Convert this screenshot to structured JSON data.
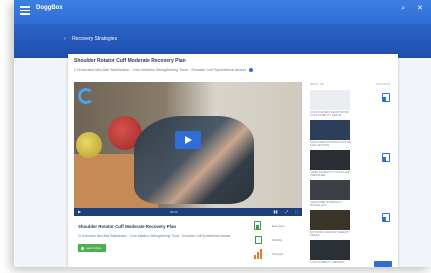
{
  "appbar": {
    "brand": "DoggBox",
    "right_icons": [
      "⌕",
      "✕"
    ]
  },
  "banner": {
    "back_label": "Recovery Strategies"
  },
  "page": {
    "title": "Shoulder Rotator Cuff Moderate Recovery Plan",
    "subtitle": "CI Exercises Mini-Ball Stabilization · Core Initiation Strengthening Trunk · Shoulder Cuff Symmetrical Awarer"
  },
  "video": {
    "controls": {
      "play": "▶",
      "time": "00:00",
      "right": [
        "▮▮",
        "⤢",
        "⛶"
      ]
    }
  },
  "info": {
    "title": "Shoulder Rotator Cuff Moderate Recovery Plan",
    "subtitle": "CI Exercises Mini-Ball Stabilization · Core Initiation Strengthening Trunk · Shoulder Cuff Symmetrical Awarer",
    "learn_button": "Learn More",
    "stats": [
      {
        "label": "Exposure",
        "icon": "meter-icon",
        "color": "#3a9b4a"
      },
      {
        "label": "Mobility",
        "icon": "gate-icon",
        "color": "#3a9b4a"
      },
      {
        "label": "Strength",
        "icon": "bars-icon",
        "color": "#e07b22"
      }
    ]
  },
  "related": {
    "head_left": "NEXT UP",
    "head_right": "APPLIED",
    "items": [
      {
        "text": "FOCUS EXERCISE ROTATOR CUFF MOBILITY SETUP",
        "color": "#e9edf2"
      },
      {
        "text": "SHOULDER ROTATION ACTIVE FLEX MOTION",
        "color": "#2c3f58"
      },
      {
        "text": "CORE STABILITY CYCLE LOW PRESSURE",
        "color": "#2a2d33"
      },
      {
        "text": "SHOULDER STRENGTH RANGE LIFT",
        "color": "#3c3f46"
      },
      {
        "text": "ROTATOR FLEXION THERAPY PRESS",
        "color": "#3b3228"
      },
      {
        "text": "CUFF STABILITY REVIEW",
        "color": "#2b2f36"
      }
    ]
  }
}
